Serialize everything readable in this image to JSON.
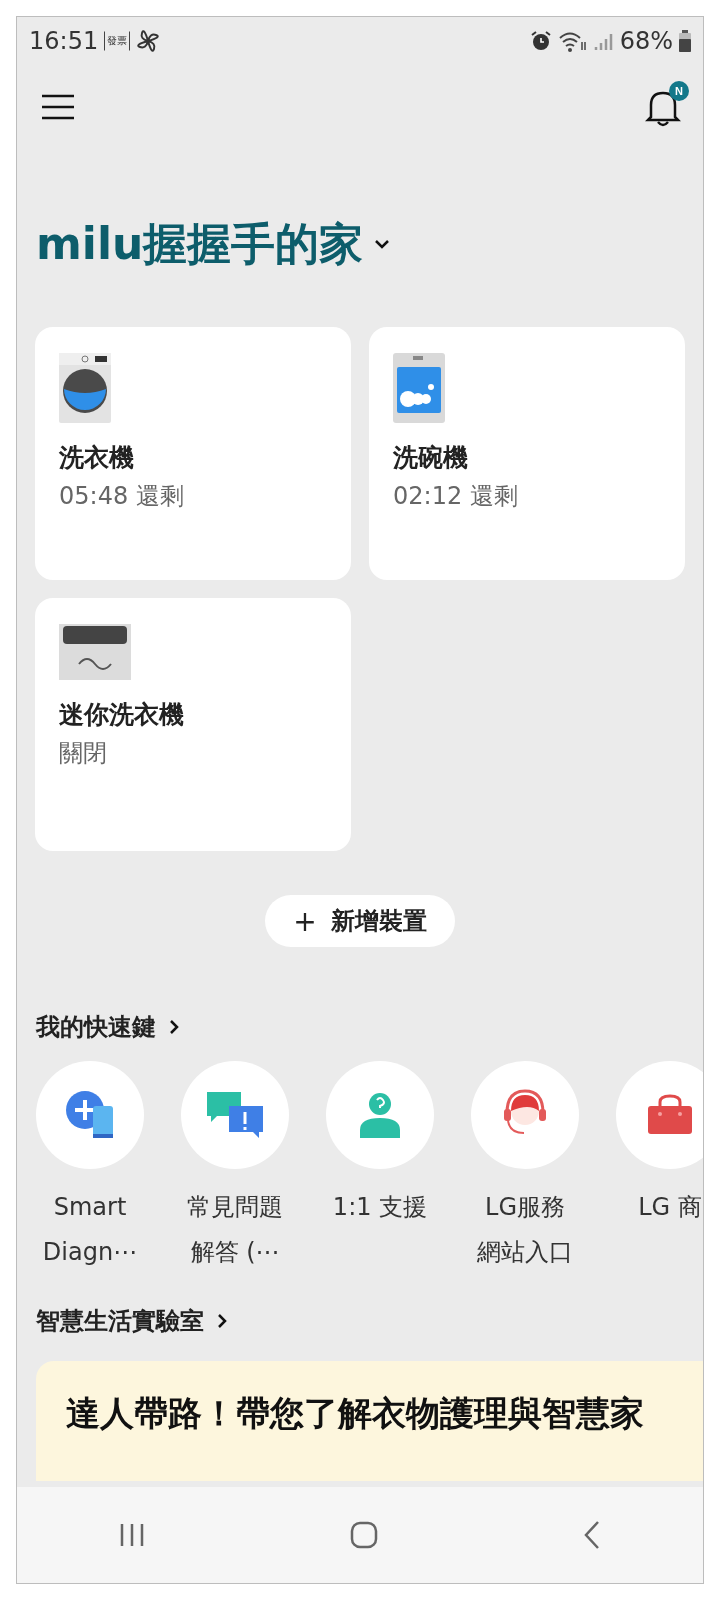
{
  "status_bar": {
    "time": "16:51",
    "notification_badge": "發票",
    "battery": "68%"
  },
  "header": {
    "notification_badge": "N"
  },
  "home": {
    "title": "milu握握手的家"
  },
  "devices": [
    {
      "kind": "washer",
      "name": "洗衣機",
      "status": "05:48 還剩"
    },
    {
      "kind": "dishwasher",
      "name": "洗碗機",
      "status": "02:12 還剩"
    },
    {
      "kind": "mini_washer",
      "name": "迷你洗衣機",
      "status": "關閉"
    }
  ],
  "add_device": {
    "label": "新增裝置",
    "icon": "+"
  },
  "shortcuts": {
    "title": "我的快速鍵",
    "items": [
      {
        "kind": "diagnosis",
        "label": "Smart Diagn⋯"
      },
      {
        "kind": "faq",
        "label": "常見問題解答 (⋯"
      },
      {
        "kind": "support",
        "label": "1:1 支援"
      },
      {
        "kind": "service",
        "label": "LG服務網站入口"
      },
      {
        "kind": "shop",
        "label": "LG 商"
      }
    ]
  },
  "lab": {
    "title": "智慧生活實驗室",
    "banner": "達人帶路！帶您了解衣物護理與智慧家"
  }
}
